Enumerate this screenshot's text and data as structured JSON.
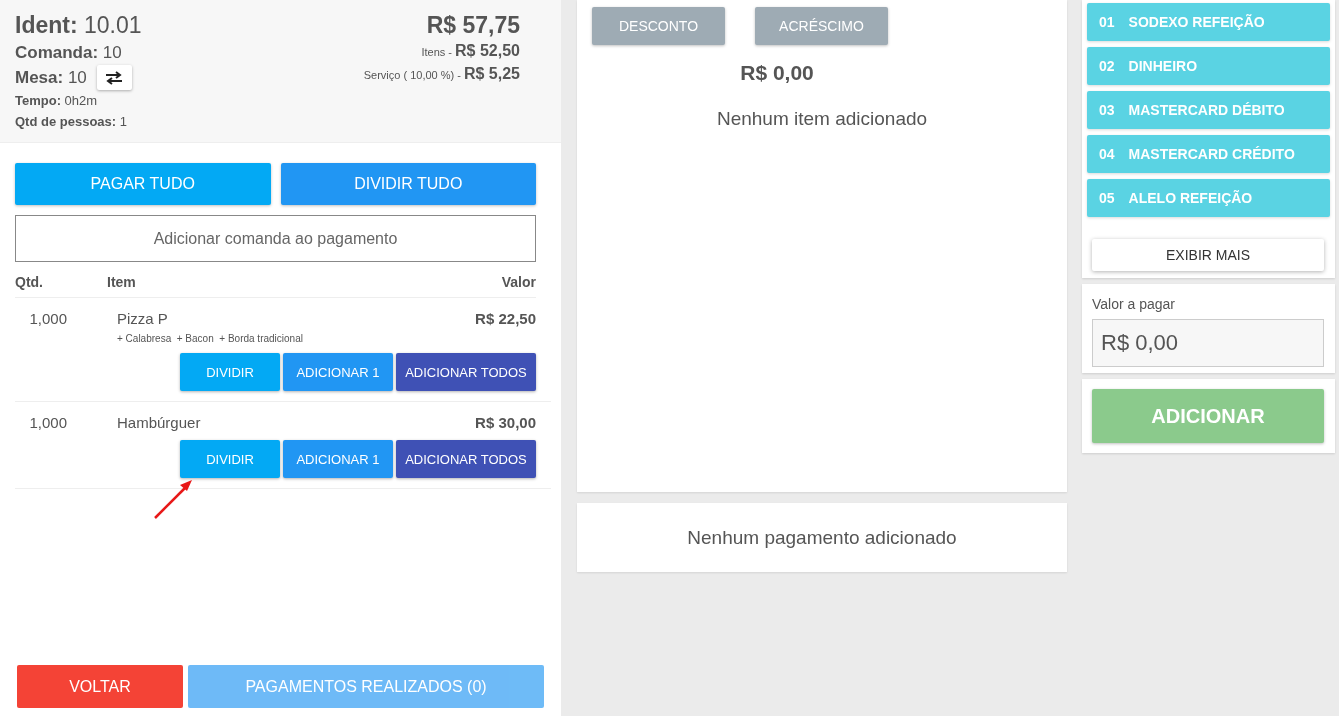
{
  "header": {
    "ident": "**Ident:** 10.01",
    "comanda": "**Comanda:** 10",
    "mesa": "**Mesa:** 10",
    "tempo": "**Tempo:** 0h2m",
    "pessoas": "**Qtd de pessoas:** 1",
    "total": "R$ 57,75",
    "itens": "Itens - **R$ 52,50**",
    "servico": "Serviço ( 10,00 %) - **R$ 5,25**"
  },
  "actions": [
    {
      "label": "PAGAR TUDO",
      "kind": "pay"
    },
    {
      "label": "DIVIDIR TUDO",
      "kind": "split"
    }
  ],
  "comanda_field": {
    "placeholder": "Adicionar comanda ao pagamento"
  },
  "table": {
    "columns": [
      "Qtd.",
      "Item",
      "Valor"
    ],
    "rows": [
      {
        "qty": "1,000",
        "name": "Pizza P",
        "extras": "+ Calabresa  + Bacon  + Borda tradicional",
        "price": "R$ 22,50",
        "buttons": [
          {
            "label": "DIVIDIR",
            "kind": "split"
          },
          {
            "label": "ADICIONAR 1",
            "kind": "add-one"
          },
          {
            "label": "ADICIONAR TODOS",
            "kind": "add-all"
          }
        ]
      },
      {
        "qty": "1,000",
        "name": "Hambúrguer",
        "price": "R$ 30,00",
        "buttons": [
          {
            "label": "DIVIDIR",
            "kind": "split"
          },
          {
            "label": "ADICIONAR 1",
            "kind": "add-one"
          },
          {
            "label": "ADICIONAR TODOS",
            "kind": "add-all"
          }
        ]
      }
    ]
  },
  "footer": [
    {
      "label": "VOLTAR",
      "kind": "back",
      "disabled": false
    },
    {
      "label": "PAGAMENTOS REALIZADOS (0)",
      "kind": "payments",
      "disabled": true
    }
  ],
  "adjustments": {
    "buttons": [
      "DESCONTO",
      "ACRÉSCIMO"
    ],
    "amount": "R$ 0,00",
    "empty_items": "Nenhum item adicionado"
  },
  "payments": {
    "empty": "Nenhum pagamento adicionado"
  },
  "methods": [
    {
      "code": "01",
      "name": "SODEXO REFEIÇÃO"
    },
    {
      "code": "02",
      "name": "DINHEIRO"
    },
    {
      "code": "03",
      "name": "MASTERCARD DÉBITO"
    },
    {
      "code": "04",
      "name": "MASTERCARD CRÉDITO"
    },
    {
      "code": "05",
      "name": "ALELO REFEIÇÃO"
    }
  ],
  "show_more": "EXIBIR MAIS",
  "amount_field": {
    "label": "Valor a pagar",
    "value": "R$ 0,00"
  },
  "add_button": "ADICIONAR"
}
